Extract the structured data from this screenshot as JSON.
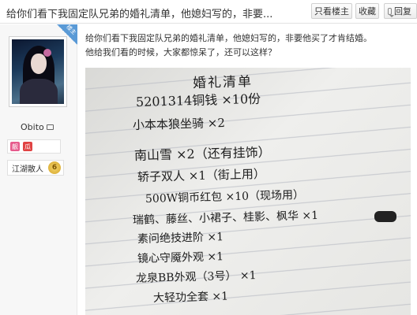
{
  "header": {
    "title": "给你们看下我固定队兄弟的婚礼清单，他媳妇写的，非要...",
    "buttons": {
      "landlord_only": "只看楼主",
      "favorite": "收藏",
      "reply": "回复"
    }
  },
  "user": {
    "name": "Obito",
    "corner_tag": "楼主",
    "badges": [
      "靓",
      "瓜"
    ],
    "rank": "江湖散人",
    "level": "6"
  },
  "post": {
    "line1": "给你们看下我固定队兄弟的婚礼清单，他媳妇写的，非要他买了才肯结婚。",
    "line2": "他给我们看的时候，大家都惊呆了，还可以这样？"
  },
  "photo": {
    "title": "婚礼清单",
    "lines": [
      "5201314铜钱 ×10份",
      "小本本狼坐骑 ×2",
      "南山雪 ×2（还有挂饰）",
      "轿子双人 ×1（街上用）",
      "500W铜币红包 ×10（现场用）",
      "瑞鹤、藤丝、小裙子、桂影、枫华 ×1",
      "素问绝技进阶 ×1",
      "镜心守魇外观 ×1",
      "龙泉BB外观（3号） ×1",
      "大轻功全套 ×1",
      "…"
    ]
  },
  "colors": {
    "corner_tag": "#5a9ad6",
    "badge_pink": "#e65a8c",
    "badge_red": "#e04343",
    "level_gold": "#d5a52a"
  }
}
